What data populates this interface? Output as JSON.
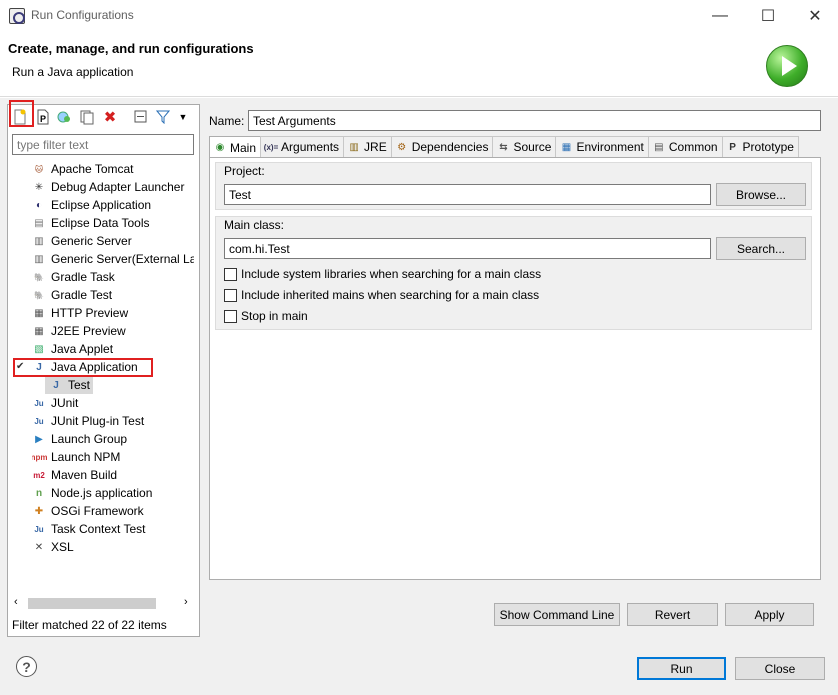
{
  "window": {
    "title": "Run Configurations",
    "minimize": "—",
    "maximize": "☐",
    "close": "✕"
  },
  "header": {
    "title": "Create, manage, and run configurations",
    "subtitle": "Run a Java application"
  },
  "filter": {
    "placeholder": "type filter text"
  },
  "tree": {
    "items": [
      {
        "label": "Apache Tomcat",
        "icon": "tomcat-icon"
      },
      {
        "label": "Debug Adapter Launcher",
        "icon": "debug-adapter-icon"
      },
      {
        "label": "Eclipse Application",
        "icon": "eclipse-icon"
      },
      {
        "label": "Eclipse Data Tools",
        "icon": "database-icon"
      },
      {
        "label": "Generic Server",
        "icon": "server-icon"
      },
      {
        "label": "Generic Server(External Lau",
        "icon": "server-icon"
      },
      {
        "label": "Gradle Task",
        "icon": "gradle-icon"
      },
      {
        "label": "Gradle Test",
        "icon": "gradle-icon"
      },
      {
        "label": "HTTP Preview",
        "icon": "http-icon"
      },
      {
        "label": "J2EE Preview",
        "icon": "j2ee-icon"
      },
      {
        "label": "Java Applet",
        "icon": "applet-icon"
      },
      {
        "label": "Java Application",
        "icon": "java-app-icon",
        "expanded": true
      },
      {
        "label": "Test",
        "icon": "java-app-icon",
        "child": true,
        "selected": true
      },
      {
        "label": "JUnit",
        "icon": "junit-icon"
      },
      {
        "label": "JUnit Plug-in Test",
        "icon": "junit-icon"
      },
      {
        "label": "Launch Group",
        "icon": "launch-group-icon"
      },
      {
        "label": "Launch NPM",
        "icon": "npm-icon"
      },
      {
        "label": "Maven Build",
        "icon": "maven-icon"
      },
      {
        "label": "Node.js application",
        "icon": "nodejs-icon"
      },
      {
        "label": "OSGi Framework",
        "icon": "osgi-icon"
      },
      {
        "label": "Task Context Test",
        "icon": "junit-icon"
      },
      {
        "label": "XSL",
        "icon": "xsl-icon"
      }
    ]
  },
  "filter_status": "Filter matched 22 of 22 items",
  "config": {
    "name_label": "Name:",
    "name_value": "Test Arguments",
    "tabs": [
      "Main",
      "Arguments",
      "JRE",
      "Dependencies",
      "Source",
      "Environment",
      "Common",
      "Prototype"
    ],
    "project_label": "Project:",
    "project_value": "Test",
    "browse_label": "Browse...",
    "main_class_label": "Main class:",
    "main_class_value": "com.hi.Test",
    "search_label": "Search...",
    "checkboxes": [
      {
        "label": "Include system libraries when searching for a main class",
        "checked": false
      },
      {
        "label": "Include inherited mains when searching for a main class",
        "checked": false
      },
      {
        "label": "Stop in main",
        "checked": false
      }
    ],
    "show_cmd_label": "Show Command Line",
    "revert_label": "Revert",
    "apply_label": "Apply"
  },
  "footer": {
    "help": "?",
    "run_label": "Run",
    "close_label": "Close"
  }
}
